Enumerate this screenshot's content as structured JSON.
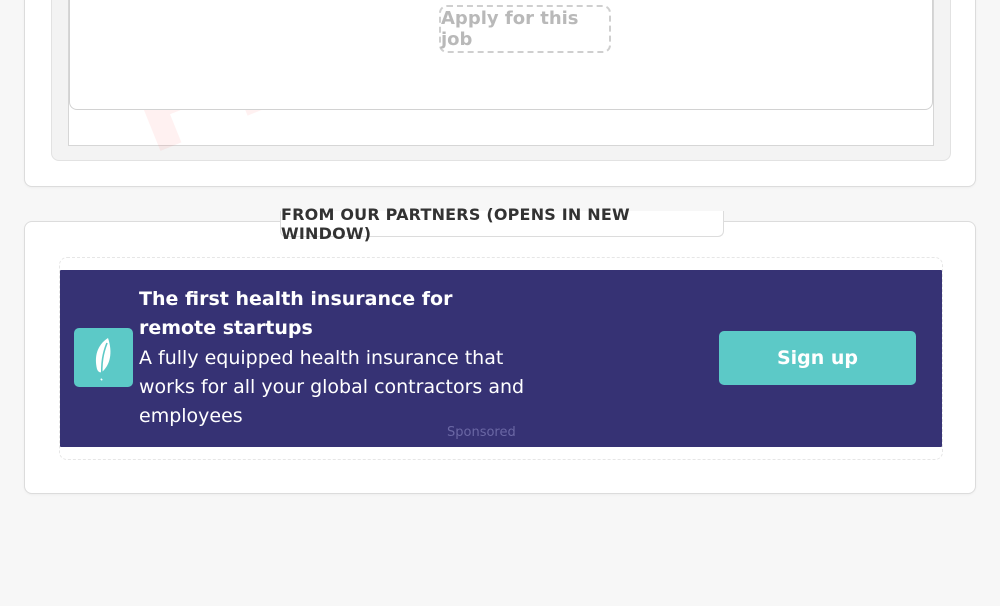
{
  "job": {
    "apply_label": "Apply for this job",
    "watermark": "PRE"
  },
  "partners": {
    "heading": "FROM OUR PARTNERS (OPENS IN NEW WINDOW)",
    "ad": {
      "logo_icon": "feather-icon",
      "title": "The first health insurance for remote startups",
      "description": "A fully equipped health insurance that works for all your global contractors and employees",
      "sponsored": "Sponsored",
      "cta": "Sign up",
      "background_color": "#363274",
      "accent_color": "#5cc9c7"
    }
  }
}
